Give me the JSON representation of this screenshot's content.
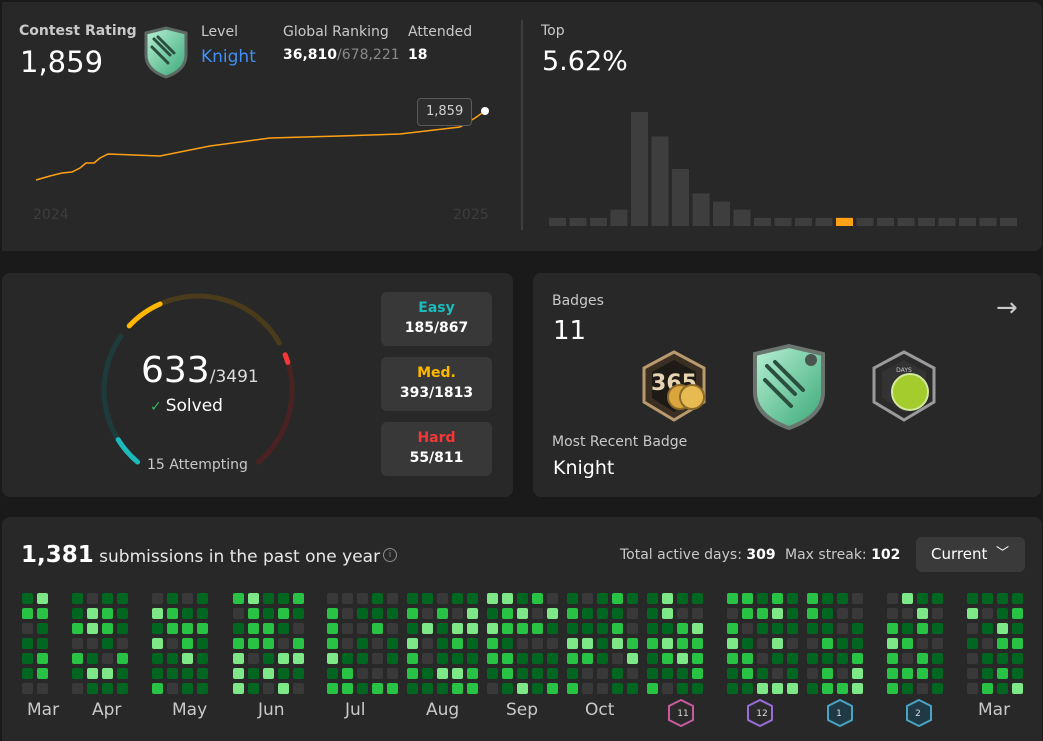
{
  "rating": {
    "label": "Contest Rating",
    "value": "1,859",
    "level_label": "Level",
    "level": "Knight",
    "ranking_label": "Global Ranking",
    "ranking": "36,810",
    "ranking_total": "/678,221",
    "attended_label": "Attended",
    "attended": "18",
    "tooltip": "1,859",
    "year_start": "2024",
    "year_end": "2025",
    "badge_icon": "knight-badge-icon"
  },
  "top": {
    "label": "Top",
    "value": "5.62%",
    "histogram": [
      1,
      1,
      1,
      2,
      14,
      11,
      7,
      4,
      3,
      2,
      1,
      1,
      1,
      1,
      1,
      1,
      1,
      1,
      1,
      1,
      1,
      1,
      1
    ],
    "highlight_index": 14,
    "bar_color": "#3e3e3e",
    "highlight_color": "#ffa116"
  },
  "solved": {
    "count": "633",
    "total": "/3491",
    "label": "Solved",
    "attempting": "15 Attempting",
    "easy_label": "Easy",
    "easy": "185/867",
    "easy_fraction": 0.213,
    "medium_label": "Med.",
    "medium": "393/1813",
    "medium_fraction": 0.217,
    "hard_label": "Hard",
    "hard": "55/811",
    "hard_fraction": 0.068,
    "colors": {
      "easy": "#1cbaba",
      "medium": "#ffb700",
      "hard": "#f63737"
    }
  },
  "badges": {
    "label": "Badges",
    "count": "11",
    "recent_label": "Most Recent Badge",
    "recent": "Knight",
    "arrow_icon": "arrow-right-icon",
    "items": [
      "365-days-badge-icon",
      "knight-badge-icon",
      "days-badge-icon"
    ]
  },
  "submissions": {
    "count": "1,381",
    "text": "submissions in the past one year",
    "active_days_label": "Total active days:",
    "active_days": "309",
    "max_streak_label": "Max streak:",
    "max_streak": "102",
    "dropdown": "Current",
    "months": [
      "Mar",
      "Apr",
      "May",
      "Jun",
      "Jul",
      "Aug",
      "Sep",
      "Oct",
      "",
      "",
      "",
      "",
      "Mar"
    ],
    "badge_icons": [
      {
        "icon": "challenge-badge-icon",
        "text": "11",
        "color": "#c75b9e"
      },
      {
        "icon": "challenge-badge-icon",
        "text": "12",
        "color": "#9a6cd9"
      },
      {
        "icon": "challenge-badge-icon",
        "text": "1",
        "color": "#4aa3c4"
      },
      {
        "icon": "challenge-badge-icon",
        "text": "2",
        "color": "#4aa3c4"
      }
    ],
    "levels": [
      "#393939",
      "#016620",
      "#28c244",
      "#7ee787"
    ]
  }
}
